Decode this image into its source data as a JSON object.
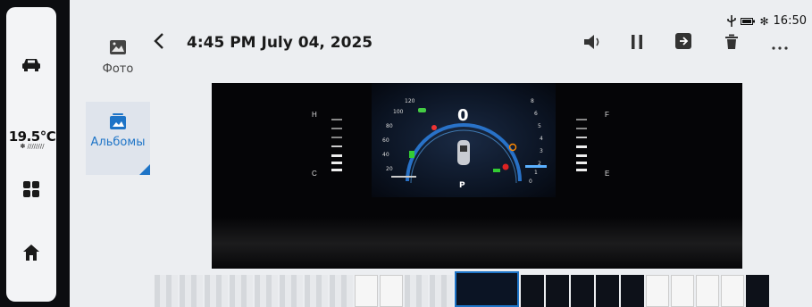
{
  "status_bar": {
    "time": "16:50"
  },
  "left_rail": {
    "temperature": "19.5°C"
  },
  "side_nav": [
    {
      "label": "Фото",
      "active": false
    },
    {
      "label": "Альбомы",
      "active": true
    }
  ],
  "viewer": {
    "title": "4:45 PM  July 04, 2025",
    "cluster": {
      "speed": "0",
      "gear": "P",
      "temp_high": "H",
      "temp_low": "C",
      "fuel_full": "F",
      "fuel_empty": "E",
      "speed_ticks": [
        "120",
        "100",
        "80",
        "60",
        "40",
        "20"
      ],
      "rpm_ticks": [
        "8",
        "6",
        "5",
        "4",
        "3",
        "2",
        "1",
        "0"
      ]
    }
  },
  "colors": {
    "accent": "#1e74c7",
    "rail": "#0c0d10",
    "panel": "#eceef1"
  }
}
